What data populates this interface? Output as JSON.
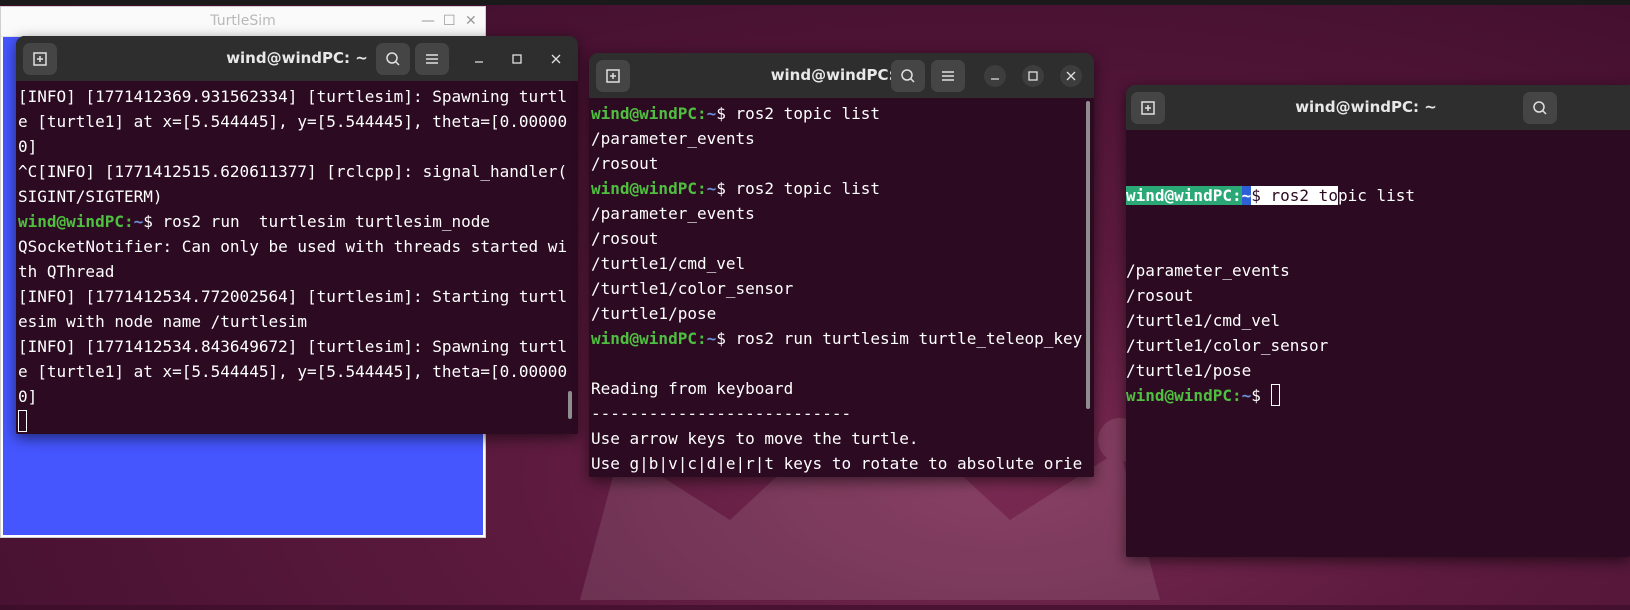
{
  "turtlesim": {
    "title": "TurtleSim",
    "minimize_glyph": "—",
    "maximize_glyph": "☐",
    "close_glyph": "✕"
  },
  "term1": {
    "title": "wind@windPC: ~",
    "lines": [
      {
        "type": "text",
        "text": "[INFO] [1771412369.931562334] [turtlesim]: Spawning turtl"
      },
      {
        "type": "text",
        "text": "e [turtle1] at x=[5.544445], y=[5.544445], theta=[0.00000"
      },
      {
        "type": "text",
        "text": "0]"
      },
      {
        "type": "text",
        "text": "^C[INFO] [1771412515.620611377] [rclcpp]: signal_handler("
      },
      {
        "type": "text",
        "text": "SIGINT/SIGTERM)"
      },
      {
        "type": "prompt",
        "userhost": "wind@windPC",
        "colon": ":",
        "path": "~",
        "dollar": "$ ",
        "cmd": "ros2 run  turtlesim turtlesim_node"
      },
      {
        "type": "text",
        "text": "QSocketNotifier: Can only be used with threads started wi"
      },
      {
        "type": "text",
        "text": "th QThread"
      },
      {
        "type": "text",
        "text": "[INFO] [1771412534.772002564] [turtlesim]: Starting turtl"
      },
      {
        "type": "text",
        "text": "esim with node name /turtlesim"
      },
      {
        "type": "text",
        "text": "[INFO] [1771412534.843649672] [turtlesim]: Spawning turtl"
      },
      {
        "type": "text",
        "text": "e [turtle1] at x=[5.544445], y=[5.544445], theta=[0.00000"
      },
      {
        "type": "text",
        "text": "0]"
      },
      {
        "type": "cursor"
      }
    ]
  },
  "term2": {
    "title": "wind@windPC: ~",
    "lines": [
      {
        "type": "prompt",
        "userhost": "wind@windPC",
        "colon": ":",
        "path": "~",
        "dollar": "$ ",
        "cmd": "ros2 topic list"
      },
      {
        "type": "text",
        "text": "/parameter_events"
      },
      {
        "type": "text",
        "text": "/rosout"
      },
      {
        "type": "prompt",
        "userhost": "wind@windPC",
        "colon": ":",
        "path": "~",
        "dollar": "$ ",
        "cmd": "ros2 topic list"
      },
      {
        "type": "text",
        "text": "/parameter_events"
      },
      {
        "type": "text",
        "text": "/rosout"
      },
      {
        "type": "text",
        "text": "/turtle1/cmd_vel"
      },
      {
        "type": "text",
        "text": "/turtle1/color_sensor"
      },
      {
        "type": "text",
        "text": "/turtle1/pose"
      },
      {
        "type": "prompt",
        "userhost": "wind@windPC",
        "colon": ":",
        "path": "~",
        "dollar": "$ ",
        "cmd": "ros2 run turtlesim turtle_teleop_key"
      },
      {
        "type": "text",
        "text": ""
      },
      {
        "type": "text",
        "text": "Reading from keyboard"
      },
      {
        "type": "text",
        "text": "---------------------------"
      },
      {
        "type": "text",
        "text": "Use arrow keys to move the turtle."
      },
      {
        "type": "text",
        "text": "Use g|b|v|c|d|e|r|t keys to rotate to absolute orie"
      }
    ]
  },
  "term3": {
    "title": "wind@windPC: ~",
    "sel_userhost": "wind@windPC",
    "sel_colon": ":",
    "sel_path": "~",
    "sel_dollar": "$ ros2 to",
    "rest_cmd": "pic list",
    "lines": [
      {
        "type": "text",
        "text": "/parameter_events"
      },
      {
        "type": "text",
        "text": "/rosout"
      },
      {
        "type": "text",
        "text": "/turtle1/cmd_vel"
      },
      {
        "type": "text",
        "text": "/turtle1/color_sensor"
      },
      {
        "type": "text",
        "text": "/turtle1/pose"
      },
      {
        "type": "prompt",
        "userhost": "wind@windPC",
        "colon": ":",
        "path": "~",
        "dollar": "$ ",
        "cmd": "",
        "cursor": true
      }
    ]
  },
  "colors": {
    "terminal_bg": "#2c0b22",
    "header_bg": "#2e2e2e",
    "prompt_user": "#4fbf3f",
    "prompt_path": "#6b8fd6",
    "turtlesim_canvas": "#4556ff",
    "selection_bg_user": "#2aa876",
    "selection_bg_path": "#2d5fd6"
  },
  "icons": [
    "new-tab-icon",
    "search-icon",
    "hamburger-menu-icon",
    "minimize-icon",
    "maximize-icon",
    "close-icon"
  ]
}
